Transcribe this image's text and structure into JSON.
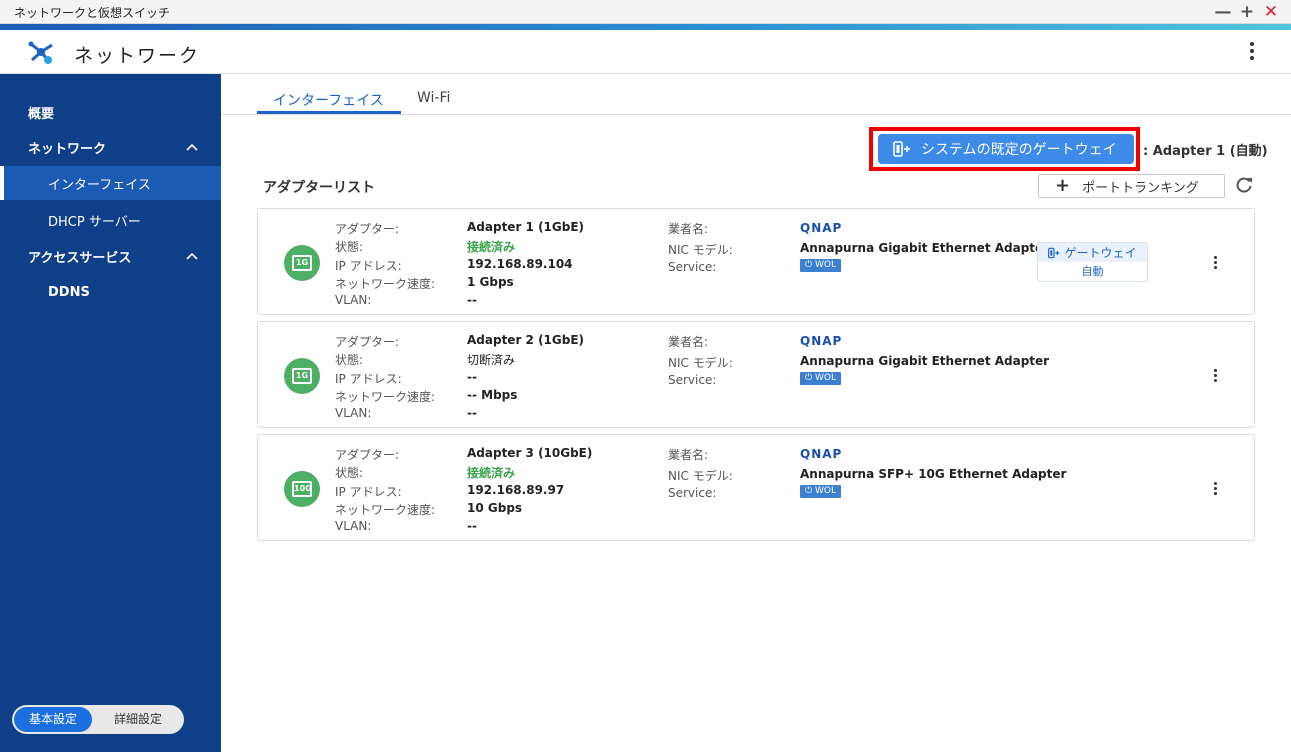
{
  "window": {
    "title": "ネットワークと仮想スイッチ",
    "minimize": "—",
    "maximize": "+",
    "close": "✕"
  },
  "header": {
    "app_title": "ネットワーク",
    "app_icon": "network-icon"
  },
  "sidebar": {
    "items": [
      {
        "label": "概要"
      },
      {
        "label": "ネットワーク"
      },
      {
        "label": "インターフェイス"
      },
      {
        "label": "DHCP サーバー"
      },
      {
        "label": "アクセスサービス"
      },
      {
        "label": "DDNS"
      }
    ],
    "mode_basic": "基本設定",
    "mode_advanced": "詳細設定"
  },
  "tabs": [
    {
      "label": "インターフェイス"
    },
    {
      "label": "Wi-Fi"
    }
  ],
  "gateway": {
    "button_label": "システムの既定のゲートウェイ",
    "value": ":  Adapter 1 (自動)"
  },
  "adapter_list": {
    "title": "アダプターリスト",
    "trunk_button": "ポートトランキング"
  },
  "field_labels": {
    "adapter": "アダプター:",
    "status": "状態:",
    "ip": "IP アドレス:",
    "speed": "ネットワーク速度:",
    "vlan": "VLAN:",
    "vendor": "業者名:",
    "nic_model": "NIC モデル:",
    "service": "Service:"
  },
  "adapters": [
    {
      "badge": "1G",
      "name": "Adapter 1 (1GbE)",
      "status": "接続済み",
      "ip": "192.168.89.104",
      "speed": "1 Gbps",
      "vlan": "--",
      "vendor": "QNAP",
      "nic_model": "Annapurna Gigabit Ethernet Adapter",
      "service": "WOL",
      "gateway_tag": "ゲートウェイ",
      "gateway_mode": "自動"
    },
    {
      "badge": "1G",
      "name": "Adapter 2 (1GbE)",
      "status": "切断済み",
      "ip": "--",
      "speed": "-- Mbps",
      "vlan": "--",
      "vendor": "QNAP",
      "nic_model": "Annapurna Gigabit Ethernet Adapter",
      "service": "WOL"
    },
    {
      "badge": "10G",
      "name": "Adapter 3 (10GbE)",
      "status": "接続済み",
      "ip": "192.168.89.97",
      "speed": "10 Gbps",
      "vlan": "--",
      "vendor": "QNAP",
      "nic_model": "Annapurna SFP+ 10G Ethernet Adapter",
      "service": "WOL"
    }
  ],
  "colors": {
    "sidebar_bg": "#0f3f86",
    "accent": "#1c63c7",
    "connected": "#3aa24a",
    "highlight": "#ee0000"
  }
}
